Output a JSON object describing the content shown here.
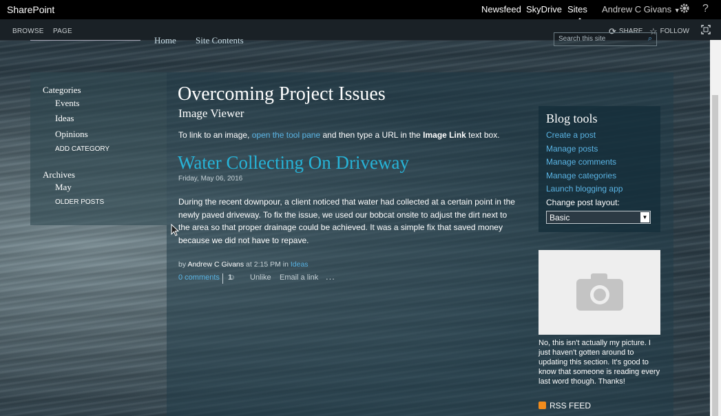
{
  "topbar": {
    "brand": "SharePoint",
    "nav": [
      "Newsfeed",
      "SkyDrive",
      "Sites"
    ],
    "selected": "Sites",
    "user": "Andrew C Givans",
    "icons": [
      "gear-icon",
      "help-icon"
    ],
    "help_glyph": "?"
  },
  "ribbon": {
    "tabs": [
      "BROWSE",
      "PAGE"
    ],
    "share": "SHARE",
    "follow": "FOLLOW",
    "icons": [
      "share-icon",
      "follow-star-icon",
      "focus-icon"
    ]
  },
  "subnav": {
    "items": [
      "Home",
      "Site Contents"
    ],
    "search_placeholder": "Search this site"
  },
  "quicklaunch": {
    "categories_heading": "Categories",
    "categories": [
      "Events",
      "Ideas",
      "Opinions"
    ],
    "add_category": "ADD CATEGORY",
    "archives_heading": "Archives",
    "archives": [
      "May"
    ],
    "older_posts": "OLDER POSTS"
  },
  "main": {
    "page_title": "Overcoming Project Issues",
    "web_part_title": "Image Viewer",
    "instruction": {
      "prefix": "To link to an image, ",
      "link": "open the tool pane",
      "middle": " and then type a URL in the ",
      "bold": "Image Link",
      "suffix": " text box."
    },
    "post": {
      "title": "Water Collecting On Driveway",
      "date": "Friday, May 06, 2016",
      "body": "During the recent downpour, a client noticed that water had collected at a certain point in the newly paved driveway. To fix the issue, we used our bobcat onsite to adjust the dirt next to the area so that proper drainage could be achieved. It was a simple fix that saved money because we did not have to repave.",
      "by": "by ",
      "author": "Andrew C Givans",
      "at": " at 2:15 PM in ",
      "category": "Ideas",
      "comments": "0 comments",
      "likes": "1",
      "unlike": "Unlike",
      "email": "Email a link",
      "more": "..."
    }
  },
  "blogtools": {
    "title": "Blog tools",
    "links": [
      "Create a post",
      "Manage posts",
      "Manage comments",
      "Manage categories",
      "Launch blogging app"
    ],
    "layout_label": "Change post layout:",
    "layout_value": "Basic"
  },
  "sidebar": {
    "photo_caption": "No, this isn't actually my picture. I just haven't gotten around to updating this section. It's good to know that someone is reading every last word though. Thanks!",
    "rss": "RSS FEED"
  },
  "colors": {
    "accent": "#27b3d7",
    "link": "#5ab4e4",
    "suitebar": "#000000"
  }
}
